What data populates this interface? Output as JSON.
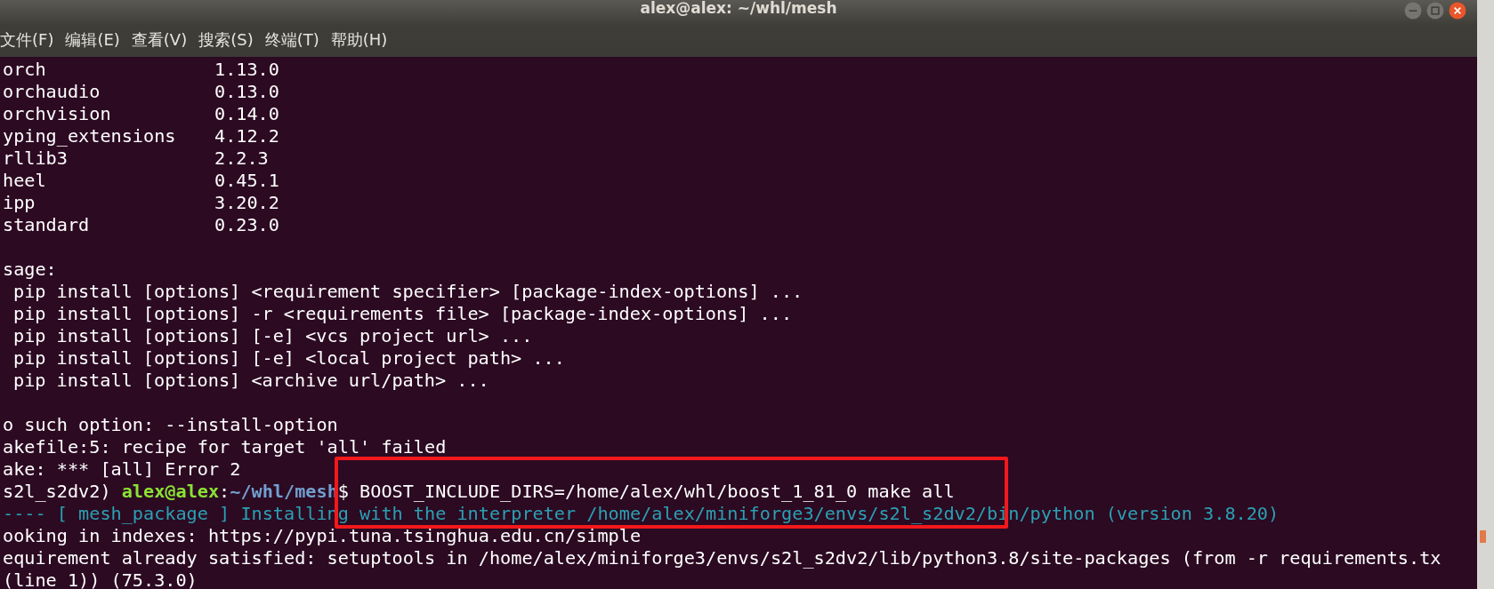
{
  "window": {
    "title": "alex@alex: ~/whl/mesh"
  },
  "menu": [
    "文件(F)",
    "编辑(E)",
    "查看(V)",
    "搜索(S)",
    "终端(T)",
    "帮助(H)"
  ],
  "lines": [
    {
      "kind": "package",
      "name": "orch",
      "version": "1.13.0"
    },
    {
      "kind": "package",
      "name": "orchaudio",
      "version": "0.13.0"
    },
    {
      "kind": "package",
      "name": "orchvision",
      "version": "0.14.0"
    },
    {
      "kind": "package",
      "name": "yping_extensions",
      "version": "4.12.2"
    },
    {
      "kind": "package",
      "name": "rllib3",
      "version": "2.2.3"
    },
    {
      "kind": "package",
      "name": "heel",
      "version": "0.45.1"
    },
    {
      "kind": "package",
      "name": "ipp",
      "version": "3.20.2"
    },
    {
      "kind": "package",
      "name": "standard",
      "version": "0.23.0"
    },
    {
      "kind": "blank"
    },
    {
      "kind": "plain",
      "text": "sage:"
    },
    {
      "kind": "indented",
      "text": "pip install [options] <requirement specifier> [package-index-options] ..."
    },
    {
      "kind": "indented",
      "text": "pip install [options] -r <requirements file> [package-index-options] ..."
    },
    {
      "kind": "indented",
      "text": "pip install [options] [-e] <vcs project url> ..."
    },
    {
      "kind": "indented",
      "text": "pip install [options] [-e] <local project path> ..."
    },
    {
      "kind": "indented",
      "text": "pip install [options] <archive url/path> ..."
    },
    {
      "kind": "blank"
    },
    {
      "kind": "plain",
      "text": "o such option: --install-option"
    },
    {
      "kind": "plain",
      "text": "akefile:5: recipe for target 'all' failed"
    },
    {
      "kind": "plain",
      "text": "ake: *** [all] Error 2"
    },
    {
      "kind": "prompt",
      "env": "s2l_s2dv2)",
      "user": "alex@alex",
      "separator": ":",
      "path": "~/whl/mesh",
      "command": "$ BOOST_INCLUDE_DIRS=/home/alex/whl/boost_1_81_0 make all"
    },
    {
      "kind": "info",
      "text": "---- [ mesh_package ] Installing with the interpreter /home/alex/miniforge3/envs/s2l_s2dv2/bin/python (version 3.8.20)"
    },
    {
      "kind": "plain",
      "text": "ooking in indexes: https://pypi.tuna.tsinghua.edu.cn/simple"
    },
    {
      "kind": "plain",
      "text": "equirement already satisfied: setuptools in /home/alex/miniforge3/envs/s2l_s2dv2/lib/python3.8/site-packages (from -r requirements.tx"
    },
    {
      "kind": "plain",
      "text": "(line 1)) (75.3.0)"
    }
  ]
}
